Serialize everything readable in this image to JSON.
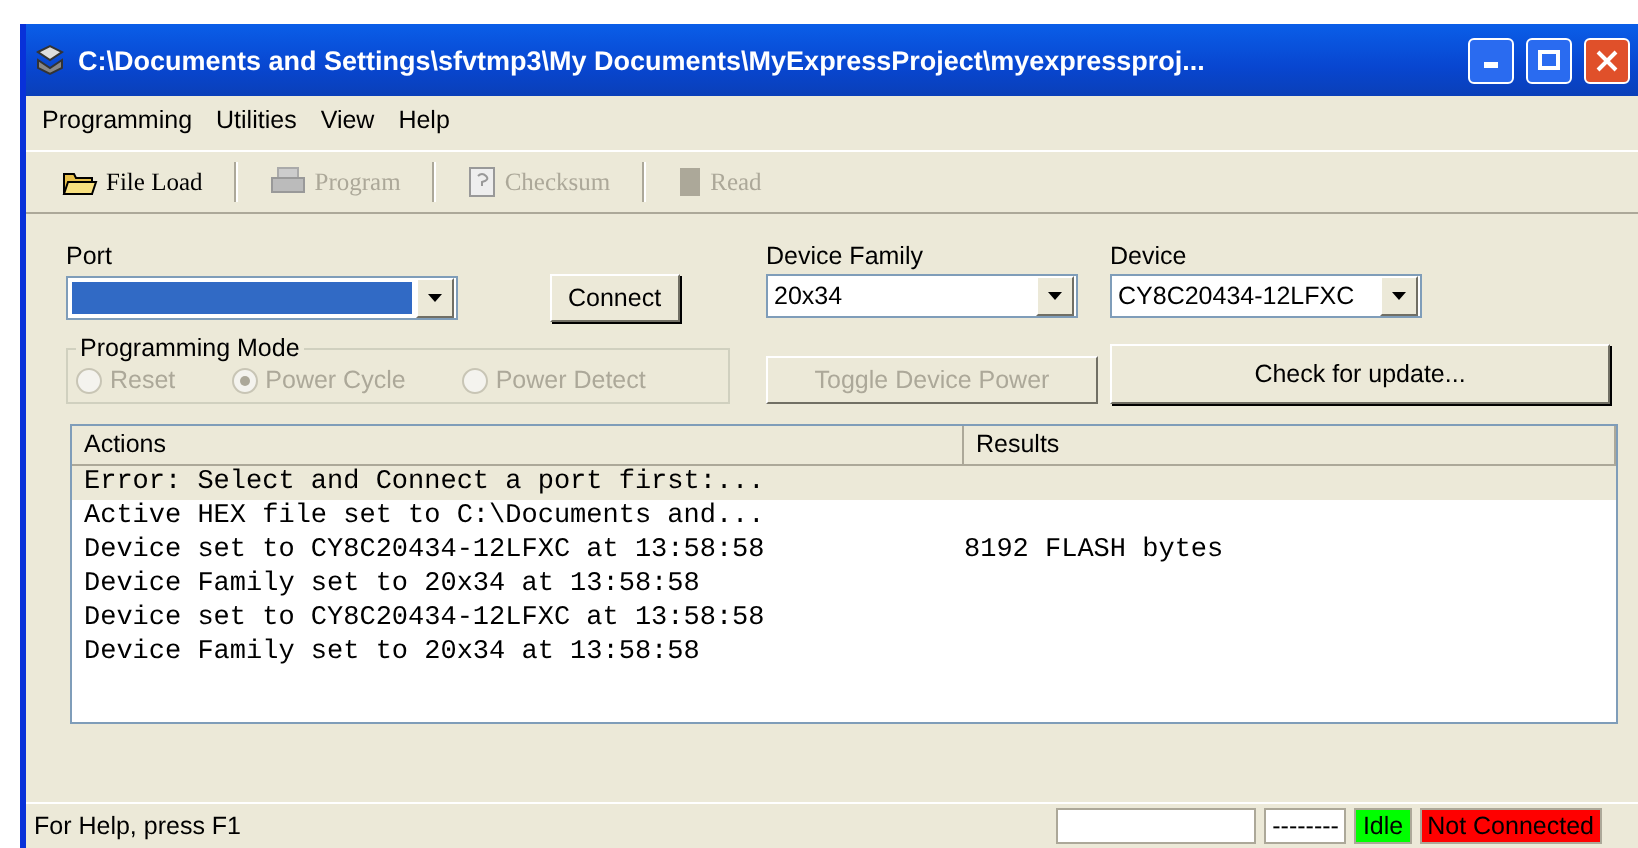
{
  "window": {
    "title": "C:\\Documents and Settings\\sfvtmp3\\My Documents\\MyExpressProject\\myexpressproj..."
  },
  "menu": [
    "Programming",
    "Utilities",
    "View",
    "Help"
  ],
  "toolbar": [
    {
      "label": "File Load",
      "disabled": false
    },
    {
      "label": "Program",
      "disabled": true
    },
    {
      "label": "Checksum",
      "disabled": true
    },
    {
      "label": "Read",
      "disabled": true
    }
  ],
  "port": {
    "label": "Port"
  },
  "connect_button": "Connect",
  "device_family": {
    "label": "Device Family",
    "value": "20x34"
  },
  "device": {
    "label": "Device",
    "value": "CY8C20434-12LFXC"
  },
  "programming_mode": {
    "label": "Programming Mode",
    "disabled": true,
    "options": [
      {
        "label": "Reset",
        "selected": false
      },
      {
        "label": "Power Cycle",
        "selected": true
      },
      {
        "label": "Power Detect",
        "selected": false
      }
    ]
  },
  "toggle_button": {
    "label": "Toggle Device Power",
    "disabled": true
  },
  "update_button": {
    "label": "Check for update...",
    "disabled": false
  },
  "log": {
    "columns": [
      "Actions",
      "Results"
    ],
    "rows": [
      {
        "action": "Error: Select and Connect a port first:...",
        "selected": true
      },
      {
        "action": "Active HEX file set to C:\\Documents and...",
        "selected": false
      },
      {
        "action": "Device set to CY8C20434-12LFXC at 13:58:58",
        "result": "8192 FLASH bytes",
        "selected": false
      },
      {
        "action": "Device Family set to 20x34 at 13:58:58",
        "selected": false
      },
      {
        "action": "Device set to CY8C20434-12LFXC at 13:58:58",
        "selected": false
      },
      {
        "action": "Device Family set to 20x34 at 13:58:58",
        "selected": false
      }
    ]
  },
  "status_bar": {
    "help": "For Help, press F1",
    "panes": [
      {
        "color": "#ffffff"
      },
      {
        "text": "--------",
        "color": "#ffffff"
      },
      {
        "text": "Idle",
        "color": "#00ff00"
      },
      {
        "text": "Not Connected",
        "color": "#ff0000"
      }
    ]
  }
}
